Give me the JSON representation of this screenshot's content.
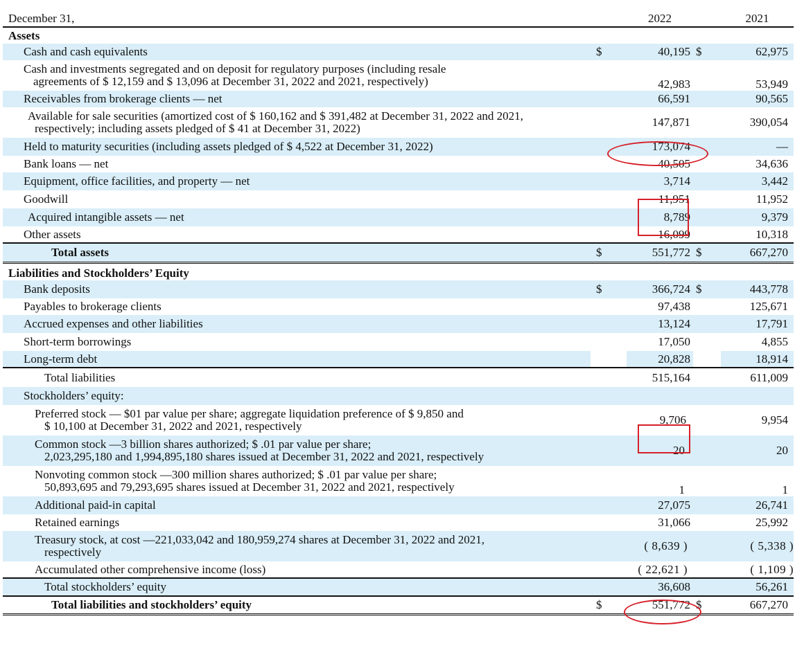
{
  "header": {
    "date_label": "December 31,",
    "year_current": "2022",
    "year_prior": "2021"
  },
  "dollar": "$",
  "assets": {
    "title": "Assets",
    "rows": [
      {
        "label": "Cash and cash equivalents",
        "v2022": "40,195",
        "v2021": "62,975",
        "dollar": true,
        "band": true
      },
      {
        "label": "Cash and investments segregated and on deposit for regulatory purposes (including resale",
        "label_cont": "agreements of $ 12,159 and $ 13,096 at December 31, 2022 and 2021, respectively)",
        "v2022": "42,983",
        "v2021": "53,949"
      },
      {
        "label": "Receivables from brokerage clients — net",
        "v2022": "66,591",
        "v2021": "90,565",
        "band": true
      },
      {
        "label": "Available for sale securities (amortized cost of $ 160,162 and $ 391,482 at December 31, 2022 and 2021,",
        "label_cont": "respectively; including assets pledged of $ 41 at December 31, 2022)",
        "v2022": "147,871",
        "v2021": "390,054"
      },
      {
        "label": "Held to maturity securities (including assets pledged of $ 4,522 at December 31, 2022)",
        "v2022": "173,074",
        "v2021": "—",
        "band": true
      },
      {
        "label": "Bank loans — net",
        "v2022": "40,505",
        "v2021": "34,636"
      },
      {
        "label": "Equipment, office facilities, and property — net",
        "v2022": "3,714",
        "v2021": "3,442",
        "band": true
      },
      {
        "label": "Goodwill",
        "v2022": "11,951",
        "v2021": "11,952"
      },
      {
        "label": "Acquired intangible assets — net",
        "v2022": "8,789",
        "v2021": "9,379",
        "band": true
      },
      {
        "label": "Other assets",
        "v2022": "16,099",
        "v2021": "10,318"
      }
    ],
    "total": {
      "label": "Total assets",
      "v2022": "551,772",
      "v2021": "667,270"
    }
  },
  "liabilities": {
    "title": "Liabilities and Stockholders’ Equity",
    "rows": [
      {
        "label": "Bank deposits",
        "v2022": "366,724",
        "v2021": "443,778"
      },
      {
        "label": "Payables to brokerage clients",
        "v2022": "97,438",
        "v2021": "125,671"
      },
      {
        "label": "Accrued expenses and other liabilities",
        "v2022": "13,124",
        "v2021": "17,791"
      },
      {
        "label": "Short-term borrowings",
        "v2022": "17,050",
        "v2021": "4,855"
      },
      {
        "label": "Long-term debt",
        "v2022": "20,828",
        "v2021": "18,914"
      }
    ],
    "total": {
      "label": "Total liabilities",
      "v2022": "515,164",
      "v2021": "611,009"
    }
  },
  "equity": {
    "title": "Stockholders’ equity:",
    "rows": [
      {
        "label": "Preferred stock — $01 par value per share; aggregate liquidation preference of $ 9,850 and",
        "label_cont": "$ 10,100 at December 31, 2022 and 2021, respectively",
        "v2022": "9,706",
        "v2021": "9,954"
      },
      {
        "label": "Common stock —3 billion shares authorized; $ .01 par value per share;",
        "label_cont": "2,023,295,180 and 1,994,895,180 shares issued at December 31, 2022 and 2021, respectively",
        "v2022": "20",
        "v2021": "20"
      },
      {
        "label": "Nonvoting common stock —300 million shares authorized; $ .01 par value per share;",
        "label_cont": "50,893,695 and 79,293,695 shares issued at December 31, 2022 and 2021, respectively",
        "v2022": "1",
        "v2021": "1"
      },
      {
        "label": "Additional paid-in capital",
        "v2022": "27,075",
        "v2021": "26,741"
      },
      {
        "label": "Retained earnings",
        "v2022": "31,066",
        "v2021": "25,992"
      },
      {
        "label": "Treasury stock, at cost —221,033,042 and 180,959,274 shares at December 31, 2022 and 2021,",
        "label_cont": "respectively",
        "v2022": "( 8,639 )",
        "v2021": "( 5,338 )"
      },
      {
        "label": "Accumulated other comprehensive income (loss)",
        "v2022": "( 22,621 )",
        "v2021": "( 1,109 )"
      }
    ],
    "total": {
      "label": "Total stockholders’ equity",
      "v2022": "36,608",
      "v2021": "56,261"
    }
  },
  "grand_total": {
    "label": "Total liabilities and stockholders’ equity",
    "v2022": "551,772",
    "v2021": "667,270"
  },
  "annotation_color": "#d6202a",
  "band_color": "#d9eef8"
}
